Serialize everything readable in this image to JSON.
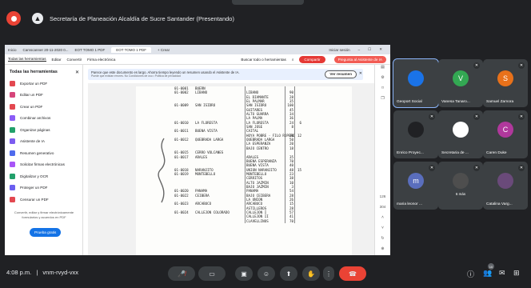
{
  "meeting": {
    "banner_title": "Secretaría de Planeación Alcaldía de Sucre Santander (Presentando)",
    "time": "4:08 p.m.",
    "separator": "|",
    "code": "vnm-rvyd-vxx"
  },
  "browser": {
    "tabs": [
      "Inicio",
      "Camscanner 20-11-2020 0...",
      "EOT TOMO 1 PDF",
      "EOT TOMO 1 PDF",
      "+ Crear"
    ],
    "signin": "Iniciar sesión"
  },
  "acrobat": {
    "menu": [
      "Todas las herramientas",
      "Editar",
      "Convertir",
      "Firma electrónica"
    ],
    "search_placeholder": "Buscar todo o herramientas",
    "share_label": "Compartir",
    "ai_label": "Pregunta al Asistente de IA",
    "panel_title": "Todas las herramientas",
    "tools": [
      {
        "label": "Exportar un PDF",
        "color": "#e34850"
      },
      {
        "label": "Editar un PDF",
        "color": "#d6457a"
      },
      {
        "label": "Crear un PDF",
        "color": "#e34850"
      },
      {
        "label": "Combinar archivos",
        "color": "#8b5cf6"
      },
      {
        "label": "Organizar páginas",
        "color": "#22a06b"
      },
      {
        "label": "Asistente de IA",
        "color": "#7c5cf0"
      },
      {
        "label": "Resumen generativo",
        "color": "#4f6bed"
      },
      {
        "label": "Solicitar firmas electrónicas",
        "color": "#a855f7"
      },
      {
        "label": "Digitalizar y OCR",
        "color": "#22a06b"
      },
      {
        "label": "Proteger un PDF",
        "color": "#6b5ff0"
      },
      {
        "label": "Censurar un PDF",
        "color": "#e34850"
      }
    ],
    "panel_footer": "Convertir, editar y firmar electrónicamente formularios y acuerdos en PDF",
    "try_label": "Prueba gratis",
    "notice": "Parece que este documento es largo. Ahorra tiempo leyendo un resumen usando el Asistente de IA.",
    "notice_sub": "Puede que existan errores. No Condiciones de uso • Politica de privacidad",
    "summary_button": "Ver resumen",
    "page_current": "126",
    "page_total": "304"
  },
  "document_rows": [
    [
      "01-0001",
      "BUERN",
      "",
      "",
      ""
    ],
    [
      "01-0002",
      "LIBANO",
      "LIBANO",
      "90",
      ""
    ],
    [
      "",
      "",
      "EL DIAMANTE",
      "28",
      ""
    ],
    [
      "",
      "",
      "EL PALMAR",
      "35",
      ""
    ],
    [
      "01-0009",
      "SAN ISIDRO",
      "SAN ISIDRO",
      "100",
      ""
    ],
    [
      "",
      "",
      "GUITARES",
      "45",
      ""
    ],
    [
      "",
      "",
      "ALTO GUARRA",
      "34",
      ""
    ],
    [
      "",
      "",
      "LA PALMA",
      "36",
      ""
    ],
    [
      "01-0010",
      "LA FLORESTA",
      "LA FLORESTA",
      "24",
      "6"
    ],
    [
      "",
      "",
      "SAN JOSE",
      "8",
      ""
    ],
    [
      "01-0011",
      "BUENA VISTA",
      "CAITAL",
      "",
      ""
    ],
    [
      "",
      "",
      "HOYA POBRE - FILO ROPERO",
      "10",
      "12"
    ],
    [
      "01-0012",
      "QUEBRADA LARGA",
      "QUEBRADA LARGA",
      "50",
      ""
    ],
    [
      "",
      "",
      "LA ESPERANZA",
      "20",
      ""
    ],
    [
      "",
      "",
      "BAJO CENTRO",
      "18",
      ""
    ],
    [
      "01-0015",
      "CERRO VOLCANES",
      "",
      "",
      ""
    ],
    [
      "01-0017",
      "ARALES",
      "ARALES",
      "35",
      ""
    ],
    [
      "",
      "",
      "BUENA ESPERANZA",
      "70",
      ""
    ],
    [
      "",
      "",
      "BUENA VISTA",
      "40",
      ""
    ],
    [
      "01-0018",
      "NARANJITO",
      "UNION NARANJITO",
      "48",
      "15"
    ],
    [
      "01-0019",
      "MONTEBELLO",
      "MONTEBELLO",
      "23",
      ""
    ],
    [
      "",
      "",
      "CERRITOS",
      "38",
      ""
    ],
    [
      "",
      "",
      "ALTO JAZMIN",
      "10",
      ""
    ],
    [
      "",
      "",
      "BAJO JAZMIN",
      "3",
      ""
    ],
    [
      "01-0020",
      "PANAMA",
      "PANAMA",
      "54",
      ""
    ],
    [
      "01-0022",
      "CEIBERA",
      "BAJO CEIBERA",
      "28",
      ""
    ],
    [
      "",
      "",
      "LA UNION",
      "26",
      ""
    ],
    [
      "01-0023",
      "ARCABUCO",
      "ARCABUCO",
      "15",
      ""
    ],
    [
      "",
      "",
      "ASTILLEROS",
      "28",
      ""
    ],
    [
      "01-0024",
      "CALLEJON COLORADO",
      "CALLEJON I",
      "57",
      ""
    ],
    [
      "",
      "",
      "CALLEJON II",
      "41",
      ""
    ],
    [
      "",
      "",
      "CLAVELLINOS",
      "70",
      ""
    ]
  ],
  "participants": [
    {
      "name": "Geoport Social",
      "initial": "",
      "color": "#1a73e8"
    },
    {
      "name": "Vanesa Tanaro...",
      "initial": "V",
      "color": "#33a853"
    },
    {
      "name": "Samuel Zamora",
      "initial": "S",
      "color": "#e8711a"
    },
    {
      "name": "Enrico Proyec...",
      "initial": "",
      "color": "#202124"
    },
    {
      "name": "Secretaria de ...",
      "initial": "",
      "color": "#ffffff"
    },
    {
      "name": "Caren Duke",
      "initial": "C",
      "color": "#b0389c"
    },
    {
      "name": "maria leonor ...",
      "initial": "m",
      "color": "#5a6ebd"
    },
    {
      "name": "",
      "initial": "",
      "color": "#4e4e4e"
    },
    {
      "name": "Catalina Varg...",
      "initial": "",
      "color": "#6a4a7a"
    }
  ],
  "tile_sub": "6 más",
  "controls": {
    "people_count": "10",
    "mic_icon": "mic-off",
    "camera_icon": "camera-off"
  }
}
